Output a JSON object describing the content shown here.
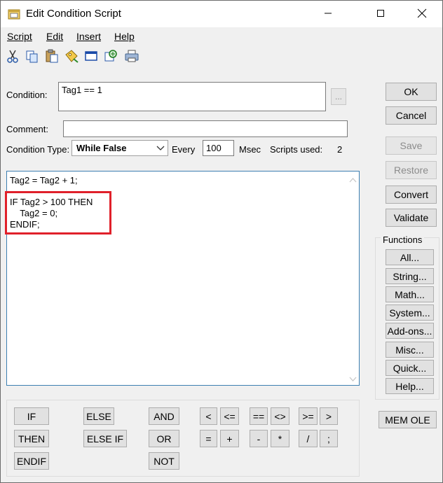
{
  "window": {
    "title": "Edit Condition Script",
    "minimize_icon": "minimize-icon",
    "maximize_icon": "maximize-icon",
    "close_icon": "close-icon"
  },
  "menu": [
    {
      "label": "Script"
    },
    {
      "label": "Edit"
    },
    {
      "label": "Insert"
    },
    {
      "label": "Help"
    }
  ],
  "toolbar": [
    "cut-icon",
    "copy-icon",
    "paste-icon",
    "tag-icon",
    "window-icon",
    "find-icon",
    "print-icon"
  ],
  "condition": {
    "label": "Condition:",
    "value": "Tag1 == 1",
    "browse_label": "..."
  },
  "comment": {
    "label": "Comment:",
    "value": ""
  },
  "condition_type": {
    "label": "Condition Type:",
    "selected": "While False",
    "every_label": "Every",
    "every_value": "100",
    "msec_label": "Msec",
    "scripts_used_label": "Scripts used:",
    "scripts_used_value": "2"
  },
  "script_lines": [
    "Tag2 = Tag2 + 1;",
    "",
    "IF Tag2 > 100 THEN",
    "    Tag2 = 0;",
    "ENDIF;"
  ],
  "side_buttons": {
    "ok": "OK",
    "cancel": "Cancel",
    "save": "Save",
    "restore": "Restore",
    "convert": "Convert",
    "validate": "Validate"
  },
  "functions": {
    "label": "Functions",
    "buttons": [
      "All...",
      "String...",
      "Math...",
      "System...",
      "Add-ons...",
      "Misc...",
      "Quick...",
      "Help..."
    ]
  },
  "mem_ole": "MEM OLE",
  "keywords": {
    "if": "IF",
    "then": "THEN",
    "endif": "ENDIF",
    "else": "ELSE",
    "else_if": "ELSE IF",
    "and": "AND",
    "or": "OR",
    "not": "NOT"
  },
  "operators": {
    "lt": "<",
    "le": "<=",
    "eq": "==",
    "ne": "<>",
    "ge": ">=",
    "gt": ">",
    "assign": "=",
    "plus": "+",
    "minus": "-",
    "times": "*",
    "divide": "/",
    "semicolon": ";"
  }
}
